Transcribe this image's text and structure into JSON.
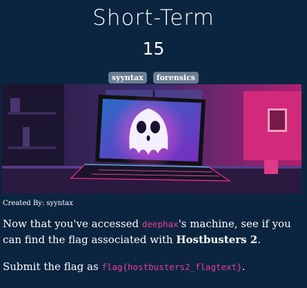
{
  "challenge": {
    "title": "Short-Term",
    "points": "15",
    "tags": [
      "syyntax",
      "forensics"
    ],
    "created_by": "Created By: syyntax",
    "description": {
      "part1": "Now that you've accessed ",
      "username": "deephax",
      "part2": "'s machine, see if you can find the flag associated with ",
      "bold": "Hostbusters 2",
      "part3": "."
    },
    "submit": {
      "prefix": "Submit the flag as ",
      "format": "flag{hostbusters2_flagtext}",
      "suffix": "."
    }
  },
  "banner": {
    "icon": "ghost-on-laptop-illustration",
    "accent": "#ff2d9b",
    "glow": "#2ee6ff"
  },
  "colors": {
    "background": "#0b2540",
    "tag": "#6b7d92",
    "code": "#e83e8c"
  }
}
